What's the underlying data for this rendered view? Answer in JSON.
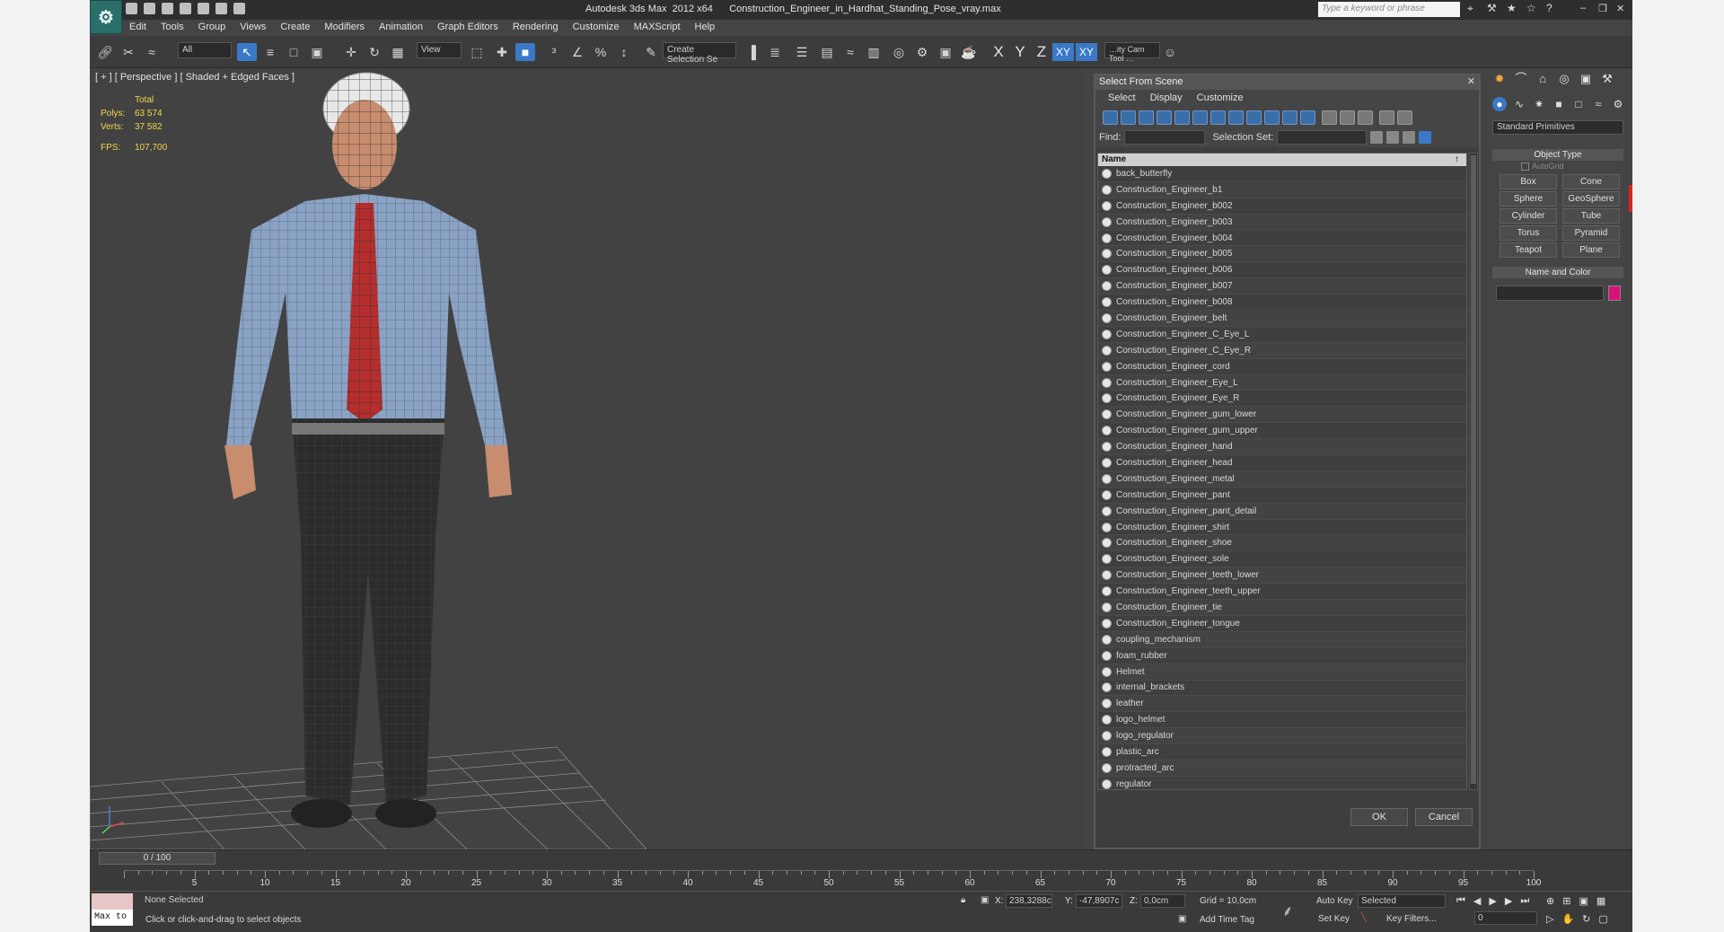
{
  "window": {
    "app": "Autodesk 3ds Max  2012 x64",
    "file": "Construction_Engineer_in_Hardhat_Standing_Pose_vray.max",
    "search_placeholder": "Type a keyword or phrase"
  },
  "menu": [
    "Edit",
    "Tools",
    "Group",
    "Views",
    "Create",
    "Modifiers",
    "Animation",
    "Graph Editors",
    "Rendering",
    "Customize",
    "MAXScript",
    "Help"
  ],
  "toolbar": {
    "filter": "All",
    "ref_coord": "View",
    "selection_set": "Create Selection Se",
    "axis_x": "X",
    "axis_y": "Y",
    "axis_z": "Z",
    "axis_xy": "XY",
    "axis_xy2": "XY",
    "cam_tool": "…ity Cam Tool …"
  },
  "viewport": {
    "label": "[ + ] [ Perspective ] [ Shaded + Edged Faces ]",
    "stats": {
      "header": "Total",
      "polys_label": "Polys:",
      "polys": "63 574",
      "verts_label": "Verts:",
      "verts": "37 582",
      "fps_label": "FPS:",
      "fps": "107,700"
    }
  },
  "dialog": {
    "title": "Select From Scene",
    "menu": [
      "Select",
      "Display",
      "Customize"
    ],
    "find_label": "Find:",
    "selset_label": "Selection Set:",
    "column_name": "Name",
    "items": [
      "back_butterfly",
      "Construction_Engineer_b1",
      "Construction_Engineer_b002",
      "Construction_Engineer_b003",
      "Construction_Engineer_b004",
      "Construction_Engineer_b005",
      "Construction_Engineer_b006",
      "Construction_Engineer_b007",
      "Construction_Engineer_b008",
      "Construction_Engineer_belt",
      "Construction_Engineer_C_Eye_L",
      "Construction_Engineer_C_Eye_R",
      "Construction_Engineer_cord",
      "Construction_Engineer_Eye_L",
      "Construction_Engineer_Eye_R",
      "Construction_Engineer_gum_lower",
      "Construction_Engineer_gum_upper",
      "Construction_Engineer_hand",
      "Construction_Engineer_head",
      "Construction_Engineer_metal",
      "Construction_Engineer_pant",
      "Construction_Engineer_pant_detail",
      "Construction_Engineer_shirt",
      "Construction_Engineer_shoe",
      "Construction_Engineer_sole",
      "Construction_Engineer_teeth_lower",
      "Construction_Engineer_teeth_upper",
      "Construction_Engineer_tie",
      "Construction_Engineer_tongue",
      "coupling_mechanism",
      "foam_rubber",
      "Helmet",
      "internal_brackets",
      "leather",
      "logo_helmet",
      "logo_regulator",
      "plastic_arc",
      "protracted_arc",
      "regulator"
    ],
    "ok": "OK",
    "cancel": "Cancel"
  },
  "command_panel": {
    "category": "Standard Primitives",
    "object_type": "Object Type",
    "autogrid": "AutoGrid",
    "buttons": [
      "Box",
      "Cone",
      "Sphere",
      "GeoSphere",
      "Cylinder",
      "Tube",
      "Torus",
      "Pyramid",
      "Teapot",
      "Plane"
    ],
    "name_and_color": "Name and Color",
    "color": "#d8127a"
  },
  "timeline": {
    "slider": "0 / 100",
    "ticks": [
      "5",
      "10",
      "15",
      "20",
      "25",
      "30",
      "35",
      "40",
      "45",
      "50",
      "55",
      "60",
      "65",
      "70",
      "75",
      "80",
      "85",
      "90",
      "95",
      "100"
    ]
  },
  "status": {
    "maxscript": "Max to",
    "selection": "None Selected",
    "prompt": "Click or click-and-drag to select objects",
    "x_label": "X:",
    "x": "238,3288c",
    "y_label": "Y:",
    "y": "-47,8907c",
    "z_label": "Z:",
    "z": "0,0cm",
    "grid": "Grid = 10,0cm",
    "add_time_tag": "Add Time Tag",
    "auto_key": "Auto Key",
    "key_mode": "Selected",
    "set_key": "Set Key",
    "key_filters": "Key Filters...",
    "frame": "0"
  }
}
